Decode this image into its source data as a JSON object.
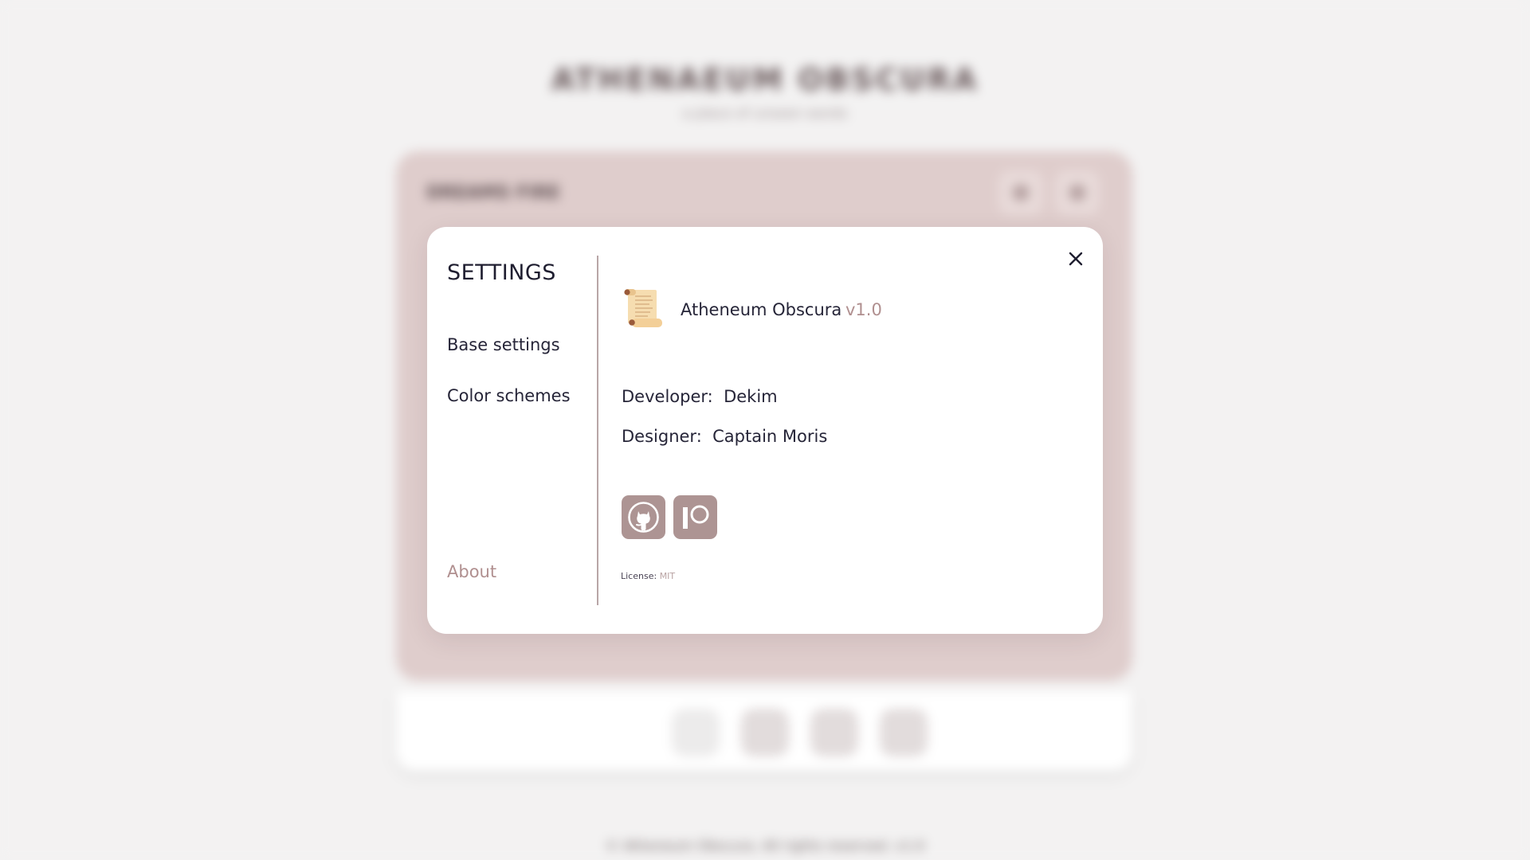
{
  "colors": {
    "accent": "#b08f8f",
    "social_button": "#ad9493",
    "divider": "#b8a6a7",
    "text": "#262538",
    "backdrop_card": "#dfcdcc"
  },
  "settings": {
    "title": "SETTINGS",
    "nav": [
      {
        "label": "Base settings",
        "active": false
      },
      {
        "label": "Color schemes",
        "active": false
      },
      {
        "label": "About",
        "active": true
      }
    ],
    "close_icon": "close-icon"
  },
  "about": {
    "app_icon": "scroll-icon",
    "app_name": "Atheneum Obscura",
    "version": "v1.0",
    "developer_label": "Developer:",
    "developer_value": "Dekim",
    "designer_label": "Designer:",
    "designer_value": "Captain Moris",
    "links": [
      {
        "icon": "github-icon"
      },
      {
        "icon": "patreon-icon"
      }
    ],
    "license_label": "License:",
    "license_value": "MIT"
  }
}
